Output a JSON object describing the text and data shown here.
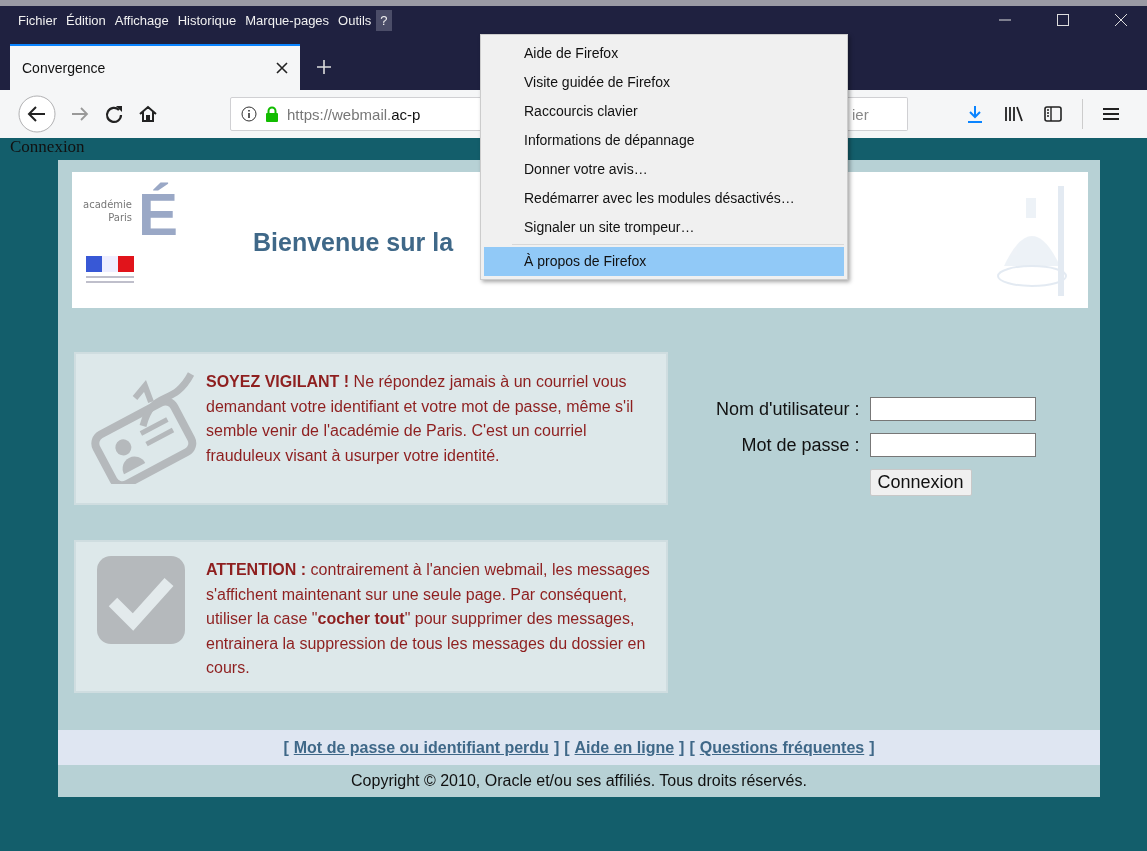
{
  "menu_bar": {
    "items": [
      {
        "label": "Fichier",
        "selected": false
      },
      {
        "label": "Édition",
        "selected": false
      },
      {
        "label": "Affichage",
        "selected": false
      },
      {
        "label": "Historique",
        "selected": false
      },
      {
        "label": "Marque-pages",
        "selected": false
      },
      {
        "label": "Outils",
        "selected": false
      },
      {
        "label": "?",
        "selected": true
      }
    ]
  },
  "tabs": [
    {
      "label": "Convergence",
      "selected": true
    }
  ],
  "toolbar": {
    "url_scheme_part": "https://webmail.",
    "url_domain_part": "ac-p",
    "search_placeholder": "ier"
  },
  "help_menu": {
    "items": [
      {
        "kind": "item",
        "label": "Aide de Firefox",
        "selected": false
      },
      {
        "kind": "item",
        "label": "Visite guidée de Firefox",
        "selected": false
      },
      {
        "kind": "item",
        "label": "Raccourcis clavier",
        "selected": false
      },
      {
        "kind": "item",
        "label": "Informations de dépannage",
        "selected": false
      },
      {
        "kind": "item",
        "label": "Donner votre avis…",
        "selected": false
      },
      {
        "kind": "item",
        "label": "Redémarrer avec les modules désactivés…",
        "selected": false
      },
      {
        "kind": "item",
        "label": "Signaler un site trompeur…",
        "selected": false
      },
      {
        "kind": "separator"
      },
      {
        "kind": "item",
        "label": "À propos de Firefox",
        "selected": true
      }
    ]
  },
  "page": {
    "caption": "Connexion",
    "header": {
      "logo_line_1": "académie",
      "logo_line_2": "Paris",
      "logo_letter": "É",
      "title": "Bienvenue sur la"
    },
    "notices": [
      {
        "kind": "phishing",
        "text": "**SOYEZ VIGILANT !** Ne répondez jamais à un courriel vous demandant votre identifiant et votre mot de passe, même s'il semble venir de l'académie de Paris. C'est un courriel frauduleux visant à usurper votre identité."
      },
      {
        "kind": "checkbox",
        "text": "**ATTENTION :** contrairement à l'ancien webmail, les messages s'affichent maintenant sur une seule page. Par conséquent, utiliser la case \"**cocher tout**\" pour supprimer des messages, entrainera la suppression de tous les messages du dossier en cours."
      }
    ],
    "login": {
      "fields": [
        {
          "label": "Nom d'utilisateur :"
        },
        {
          "label": "Mot de passe :"
        }
      ],
      "button": "Connexion"
    },
    "footer": {
      "bracket_open": "[",
      "bracket_close": "]",
      "links": [
        "Mot de passe ou identifiant perdu",
        "Aide en ligne",
        "Questions fréquentes"
      ],
      "copyright": "Copyright © 2010, Oracle et/ou ses affiliés. Tous droits réservés."
    }
  }
}
